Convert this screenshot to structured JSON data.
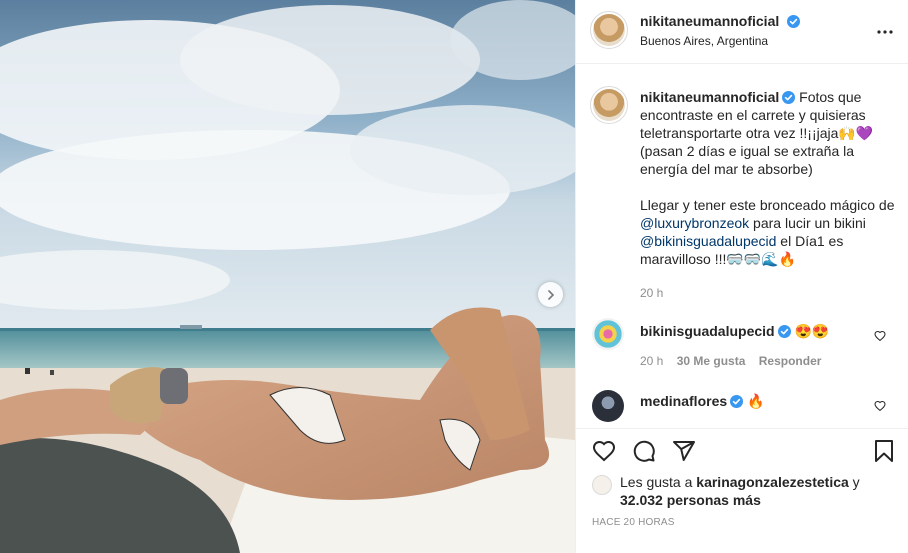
{
  "post": {
    "author": "nikitaneumannoficial",
    "location": "Buenos Aires, Argentina",
    "caption": {
      "p1_text": "Fotos que encontraste en el carrete y quisieras teletransportarte otra vez !!¡¡jaja",
      "p1_emoji": "🙌💜",
      "p1_tail": "(pasan 2 días e igual se extraña la energía del mar te absorbe)",
      "p2_a": "Llegar y tener este bronceado mágico de ",
      "p2_mention1": "@luxurybronzeok",
      "p2_b": " para lucir un bikini ",
      "p2_mention2": "@bikinisguadalupecid",
      "p2_c": " el Día1 es maravilloso !!!",
      "p2_emoji": "🥽🥽🌊🔥",
      "time": "20 h"
    }
  },
  "comments": [
    {
      "username": "bikinisguadalupecid",
      "text": "😍😍",
      "time": "20 h",
      "likes": "30 Me gusta",
      "reply": "Responder"
    },
    {
      "username": "medinaflores",
      "text": "🔥"
    }
  ],
  "likes": {
    "prefix": "Les gusta a ",
    "user": "karinagonzalezestetica",
    "mid": " y",
    "others": "32.032 personas más"
  },
  "timestamp": "HACE 20 HORAS",
  "icons": [
    "heart-icon",
    "comment-icon",
    "share-icon",
    "bookmark-icon",
    "more-icon",
    "verified-icon",
    "chevron-right-icon"
  ],
  "colors": {
    "verified": "#3897f0",
    "mention": "#00376b",
    "secondary": "#8e8e8e",
    "border": "#efefef"
  }
}
